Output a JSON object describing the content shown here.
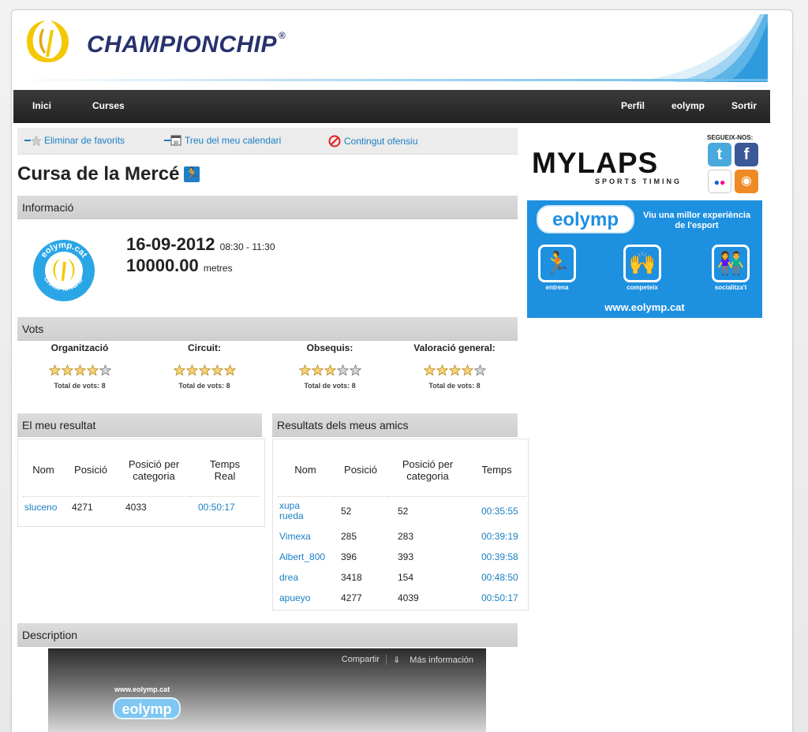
{
  "header": {
    "brand": "CHAMPIONCHIP",
    "registered": "®"
  },
  "nav": {
    "left": [
      "Inici",
      "Curses"
    ],
    "right": [
      "Perfil",
      "eolymp",
      "Sortir"
    ]
  },
  "actions": {
    "remove_favorites": "Eliminar de favorits",
    "remove_calendar": "Treu del meu calendari",
    "calendar_icon_text": "30",
    "offensive": "Contingut ofensiu"
  },
  "race": {
    "title": "Cursa de la Mercé"
  },
  "info": {
    "heading": "Informació",
    "logo_top": "eolymp.cat",
    "logo_bottom": "CHAMPIONCHIP",
    "date": "16-09-2012",
    "time": "08:30 - 11:30",
    "distance": "10000.00",
    "unit": "metres"
  },
  "votes": {
    "heading": "Vots",
    "categories": [
      {
        "label": "Organització",
        "rating": 4,
        "count": "Total de vots: 8"
      },
      {
        "label": "Circuit:",
        "rating": 5,
        "count": "Total de vots: 8"
      },
      {
        "label": "Obsequis:",
        "rating": 3,
        "count": "Total de vots: 8"
      },
      {
        "label": "Valoració general:",
        "rating": 4,
        "count": "Total de vots: 8"
      }
    ]
  },
  "my_result": {
    "heading": "El meu resultat",
    "columns": [
      "Nom",
      "Posició",
      "Posició per categoria",
      "Temps Real"
    ],
    "rows": [
      {
        "name": "sluceno",
        "pos": "4271",
        "cat": "4033",
        "time": "00:50:17"
      }
    ]
  },
  "friends": {
    "heading": "Resultats dels meus amics",
    "columns": [
      "Nom",
      "Posició",
      "Posició per categoria",
      "Temps"
    ],
    "rows": [
      {
        "name": "xupa rueda",
        "pos": "52",
        "cat": "52",
        "time": "00:35:55"
      },
      {
        "name": "Vimexa",
        "pos": "285",
        "cat": "283",
        "time": "00:39:19"
      },
      {
        "name": "Albert_800",
        "pos": "396",
        "cat": "393",
        "time": "00:39:58"
      },
      {
        "name": "drea",
        "pos": "3418",
        "cat": "154",
        "time": "00:48:50"
      },
      {
        "name": "apueyo",
        "pos": "4277",
        "cat": "4039",
        "time": "00:50:17"
      }
    ]
  },
  "sidebar": {
    "mylaps": "MYLAPS",
    "mylaps_sub": "SPORTS TIMING",
    "follow": "SEGUEIX-NOS:",
    "social": [
      {
        "name": "twitter",
        "glyph": "t",
        "color": "#4aa9dc"
      },
      {
        "name": "facebook",
        "glyph": "f",
        "color": "#3b5998"
      },
      {
        "name": "flickr",
        "glyph": "●●",
        "color": "#ffffff"
      },
      {
        "name": "rss",
        "glyph": "◉",
        "color": "#f08a24"
      }
    ],
    "banner": {
      "pill": "eolymp",
      "tagline": "Viu una millor experiència de l'esport",
      "features": [
        "entrena",
        "competeix",
        "socialitza't"
      ],
      "url": "www.eolymp.cat"
    }
  },
  "description": {
    "heading": "Description",
    "video_share": "Compartir",
    "video_more": "Más información",
    "video_url": "www.eolymp.cat",
    "video_pill": "eolymp"
  }
}
